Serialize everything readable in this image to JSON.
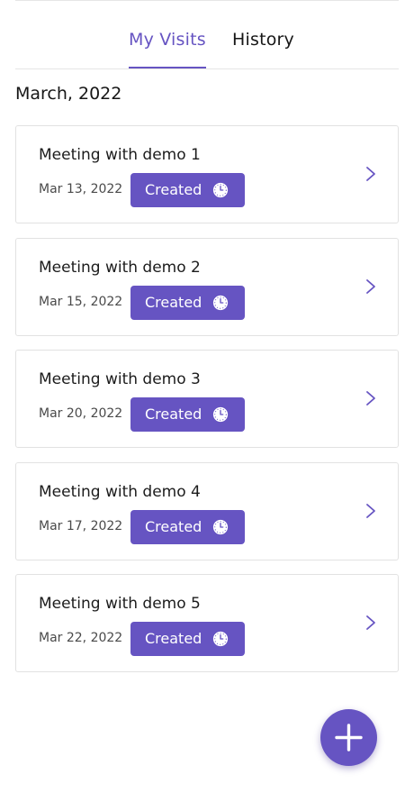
{
  "tabs": [
    {
      "label": "My Visits",
      "active": true
    },
    {
      "label": "History",
      "active": false
    }
  ],
  "month_header": "March, 2022",
  "visits": [
    {
      "title": "Meeting with demo 1",
      "date": "Mar 13, 2022",
      "status": "Created",
      "status_icon": "clock-icon"
    },
    {
      "title": "Meeting with demo 2",
      "date": "Mar 15, 2022",
      "status": "Created",
      "status_icon": "clock-icon"
    },
    {
      "title": "Meeting with demo 3",
      "date": "Mar 20, 2022",
      "status": "Created",
      "status_icon": "clock-icon"
    },
    {
      "title": "Meeting with demo 4",
      "date": "Mar 17, 2022",
      "status": "Created",
      "status_icon": "clock-icon"
    },
    {
      "title": "Meeting with demo 5",
      "date": "Mar 22, 2022",
      "status": "Created",
      "status_icon": "clock-icon"
    }
  ],
  "fab_icon": "plus-icon",
  "colors": {
    "accent": "#6654c2",
    "text": "#1f1f1f",
    "border": "#e2e2e2"
  }
}
